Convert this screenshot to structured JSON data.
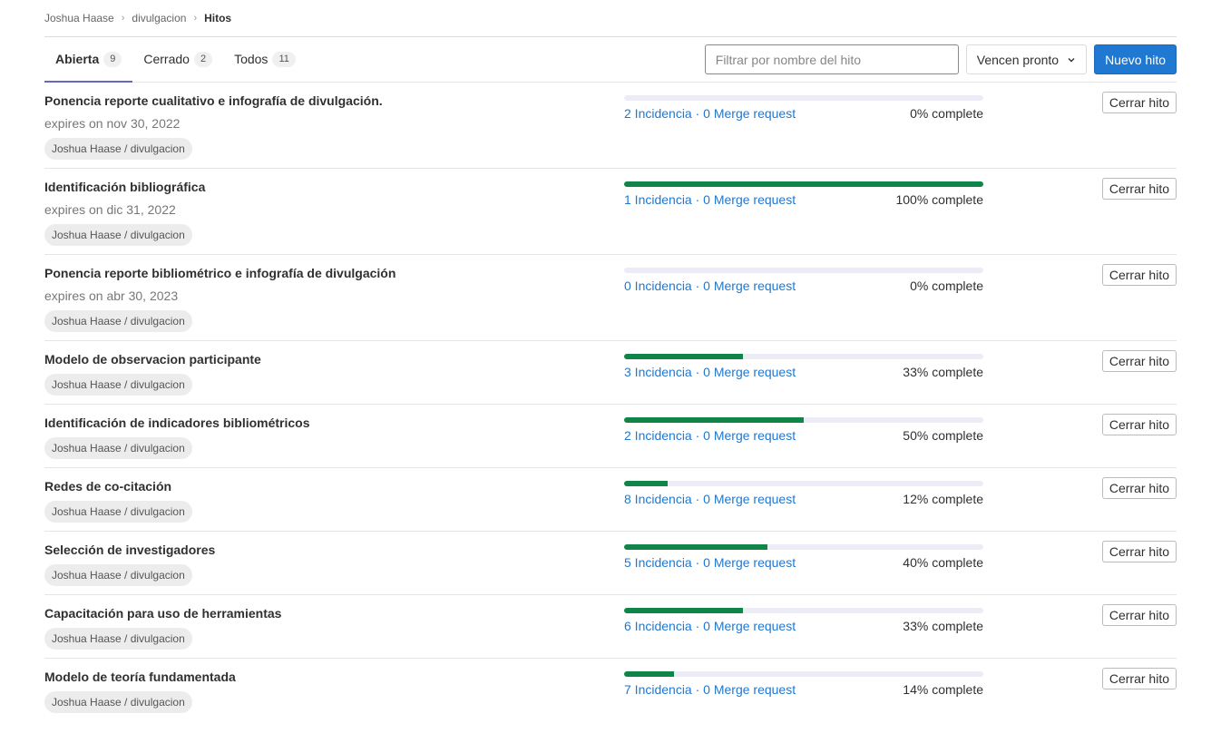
{
  "breadcrumb": [
    "Joshua Haase",
    "divulgacion",
    "Hitos"
  ],
  "tabs": [
    {
      "label": "Abierta",
      "count": "9",
      "active": true
    },
    {
      "label": "Cerrado",
      "count": "2",
      "active": false
    },
    {
      "label": "Todos",
      "count": "11",
      "active": false
    }
  ],
  "filter": {
    "placeholder": "Filtrar por nombre del hito",
    "value": ""
  },
  "sort": {
    "label": "Vencen pronto"
  },
  "new_button": {
    "label": "Nuevo hito"
  },
  "colors": {
    "accent": "#1f78d1",
    "progress": "#108548",
    "tab_active": "#6666c4"
  },
  "milestones": [
    {
      "title": "Ponencia reporte cualitativo e infografía de divulgación.",
      "expires": "expires on nov 30, 2022",
      "project": "Joshua Haase / divulgacion",
      "links": "2 Incidencia · 0 Merge request",
      "complete": "0% complete",
      "progress": 0,
      "close_label": "Cerrar hito"
    },
    {
      "title": "Identificación bibliográfica",
      "expires": "expires on dic 31, 2022",
      "project": "Joshua Haase / divulgacion",
      "links": "1 Incidencia · 0 Merge request",
      "complete": "100% complete",
      "progress": 100,
      "close_label": "Cerrar hito"
    },
    {
      "title": "Ponencia reporte bibliométrico e infografía de divulgación",
      "expires": "expires on abr 30, 2023",
      "project": "Joshua Haase / divulgacion",
      "links": "0 Incidencia · 0 Merge request",
      "complete": "0% complete",
      "progress": 0,
      "close_label": "Cerrar hito"
    },
    {
      "title": "Modelo de observacion participante",
      "expires": null,
      "project": "Joshua Haase / divulgacion",
      "links": "3 Incidencia · 0 Merge request",
      "complete": "33% complete",
      "progress": 33,
      "close_label": "Cerrar hito"
    },
    {
      "title": "Identificación de indicadores bibliométricos",
      "expires": null,
      "project": "Joshua Haase / divulgacion",
      "links": "2 Incidencia · 0 Merge request",
      "complete": "50% complete",
      "progress": 50,
      "close_label": "Cerrar hito"
    },
    {
      "title": "Redes de co-citación",
      "expires": null,
      "project": "Joshua Haase / divulgacion",
      "links": "8 Incidencia · 0 Merge request",
      "complete": "12% complete",
      "progress": 12,
      "close_label": "Cerrar hito"
    },
    {
      "title": "Selección de investigadores",
      "expires": null,
      "project": "Joshua Haase / divulgacion",
      "links": "5 Incidencia · 0 Merge request",
      "complete": "40% complete",
      "progress": 40,
      "close_label": "Cerrar hito"
    },
    {
      "title": "Capacitación para uso de herramientas",
      "expires": null,
      "project": "Joshua Haase / divulgacion",
      "links": "6 Incidencia · 0 Merge request",
      "complete": "33% complete",
      "progress": 33,
      "close_label": "Cerrar hito"
    },
    {
      "title": "Modelo de teoría fundamentada",
      "expires": null,
      "project": "Joshua Haase / divulgacion",
      "links": "7 Incidencia · 0 Merge request",
      "complete": "14% complete",
      "progress": 14,
      "close_label": "Cerrar hito"
    }
  ]
}
